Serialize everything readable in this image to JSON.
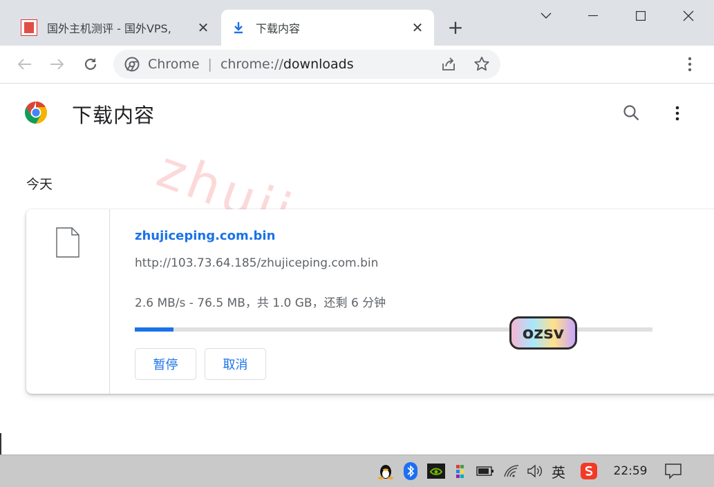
{
  "tabs": [
    {
      "label": "国外主机测评 - 国外VPS,",
      "close": "✕"
    },
    {
      "label": "下载内容",
      "close": "✕"
    }
  ],
  "new_tab": "+",
  "omnibox": {
    "scheme": "Chrome",
    "separator": "|",
    "host_prefix": "chrome://",
    "host_path": "downloads"
  },
  "page": {
    "title": "下载内容"
  },
  "section": {
    "today": "今天"
  },
  "download": {
    "file_name": "zhujiceping.com.bin",
    "url": "http://103.73.64.185/zhujiceping.com.bin",
    "status": "2.6 MB/s - 76.5 MB，共 1.0 GB，还剩 6 分钟",
    "progress_percent": 7.5,
    "pause_label": "暂停",
    "cancel_label": "取消"
  },
  "watermark": {
    "text": "zhujiceping.com",
    "sticker": "ozsv"
  },
  "taskbar": {
    "ime": "英",
    "time": "22:59"
  },
  "colors": {
    "accent": "#1a73e8",
    "tabbar": "#dee1e6",
    "taskbar": "#c9c9c9"
  }
}
